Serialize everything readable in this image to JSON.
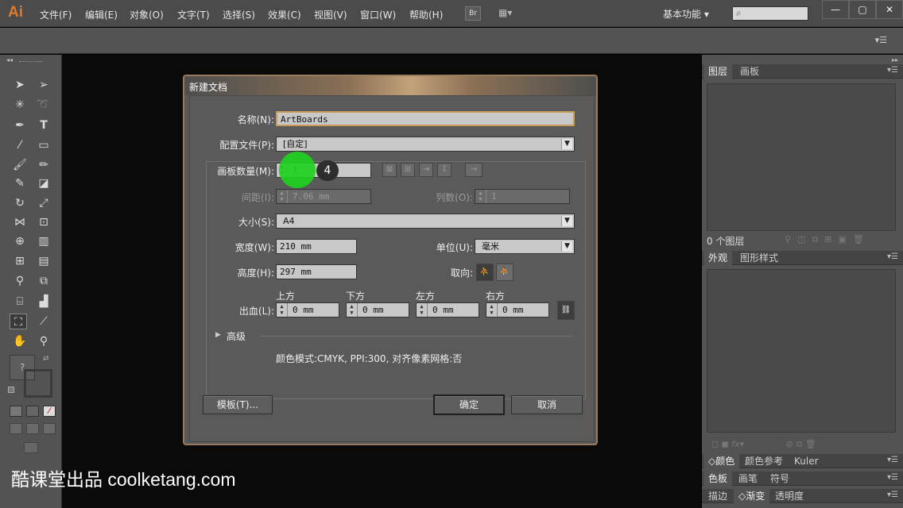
{
  "app": {
    "logo": "Ai",
    "bridge": "Br",
    "arrange": "▦▾"
  },
  "menu": [
    "文件(F)",
    "编辑(E)",
    "对象(O)",
    "文字(T)",
    "选择(S)",
    "效果(C)",
    "视图(V)",
    "窗口(W)",
    "帮助(H)"
  ],
  "workspace": "基本功能",
  "window": {
    "min": "—",
    "max": "▢",
    "close": "✕"
  },
  "right_panel": {
    "tabs1": [
      "图层",
      "画板"
    ],
    "layer_count": "0 个图层",
    "tabs2": [
      "外观",
      "图形样式"
    ],
    "tabs3": [
      "颜色",
      "颜色参考",
      "Kuler"
    ],
    "tabs4": [
      "色板",
      "画笔",
      "符号"
    ],
    "tabs5": [
      "描边",
      "渐变",
      "透明度"
    ]
  },
  "dialog": {
    "title": "新建文档",
    "name_label": "名称(N):",
    "name_value": "ArtBoards",
    "profile_label": "配置文件(P):",
    "profile_value": "[自定]",
    "artboards_label": "画板数量(M):",
    "artboards_value": "1",
    "artboards_badge": "4",
    "spacing_label": "间距(I):",
    "spacing_value": "7.06 mm",
    "columns_label": "列数(O):",
    "columns_value": "1",
    "size_label": "大小(S):",
    "size_value": "A4",
    "width_label": "宽度(W):",
    "width_value": "210 mm",
    "units_label": "单位(U):",
    "units_value": "毫米",
    "height_label": "高度(H):",
    "height_value": "297 mm",
    "orient_label": "取向:",
    "bleed_label": "出血(L):",
    "bleed_top": "上方",
    "bleed_bottom": "下方",
    "bleed_left": "左方",
    "bleed_right": "右方",
    "bleed_value": "0 mm",
    "advanced": "高级",
    "info": "颜色模式:CMYK, PPI:300, 对齐像素网格:否",
    "template_btn": "模板(T)...",
    "ok_btn": "确定",
    "cancel_btn": "取消",
    "highlight_color": "#1fd11f"
  },
  "toolbar_question": "?",
  "watermark": "酷课堂出品 coolketang.com"
}
